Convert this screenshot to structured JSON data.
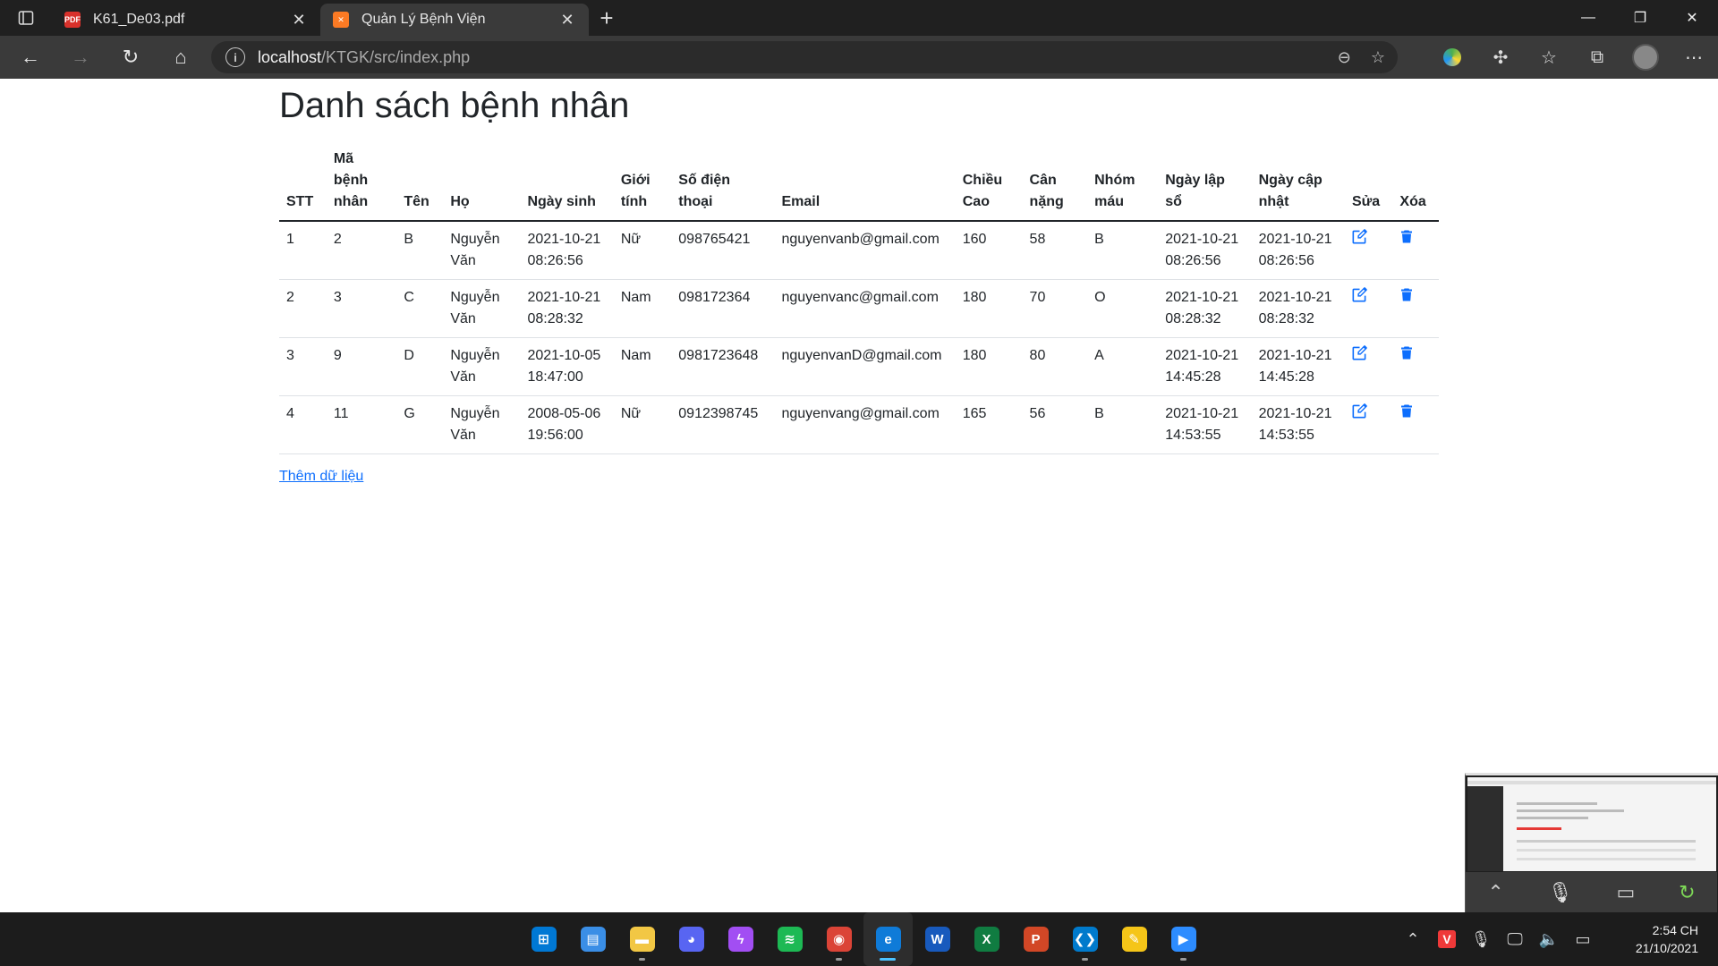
{
  "browser": {
    "tabs": [
      {
        "label": "K61_De03.pdf",
        "icon": "pdf-icon",
        "active": false
      },
      {
        "label": "Quản Lý Bệnh Viện",
        "icon": "xampp-icon",
        "active": true
      }
    ],
    "address": {
      "host": "localhost",
      "path": "/KTGK/src/index.php"
    }
  },
  "page": {
    "title": "Danh sách bệnh nhân",
    "columns": [
      "STT",
      "Mã bệnh nhân",
      "Tên",
      "Họ",
      "Ngày sinh",
      "Giới tính",
      "Số điện thoại",
      "Email",
      "Chiều Cao",
      "Cân nặng",
      "Nhóm máu",
      "Ngày lập sổ",
      "Ngày cập nhật",
      "Sửa",
      "Xóa"
    ],
    "rows": [
      [
        "1",
        "2",
        "B",
        "Nguyễn Văn",
        "2021-10-21 08:26:56",
        "Nữ",
        "098765421",
        "nguyenvanb@gmail.com",
        "160",
        "58",
        "B",
        "2021-10-21 08:26:56",
        "2021-10-21 08:26:56"
      ],
      [
        "2",
        "3",
        "C",
        "Nguyễn Văn",
        "2021-10-21 08:28:32",
        "Nam",
        "098172364",
        "nguyenvanc@gmail.com",
        "180",
        "70",
        "O",
        "2021-10-21 08:28:32",
        "2021-10-21 08:28:32"
      ],
      [
        "3",
        "9",
        "D",
        "Nguyễn Văn",
        "2021-10-05 18:47:00",
        "Nam",
        "0981723648",
        "nguyenvanD@gmail.com",
        "180",
        "80",
        "A",
        "2021-10-21 14:45:28",
        "2021-10-21 14:45:28"
      ],
      [
        "4",
        "11",
        "G",
        "Nguyễn Văn",
        "2008-05-06 19:56:00",
        "Nữ",
        "0912398745",
        "nguyenvang@gmail.com",
        "165",
        "56",
        "B",
        "2021-10-21 14:53:55",
        "2021-10-21 14:53:55"
      ]
    ],
    "add_link": "Thêm dữ liệu"
  },
  "taskbar": {
    "apps": [
      "windows-start",
      "task-view",
      "file-explorer",
      "discord",
      "messenger",
      "spotify",
      "chrome",
      "edge",
      "word",
      "excel",
      "powerpoint",
      "vscode",
      "paint",
      "zoom"
    ],
    "time": "2:54 CH",
    "date": "21/10/2021"
  },
  "colors": {
    "link": "#0d6efd",
    "text": "#212529"
  }
}
